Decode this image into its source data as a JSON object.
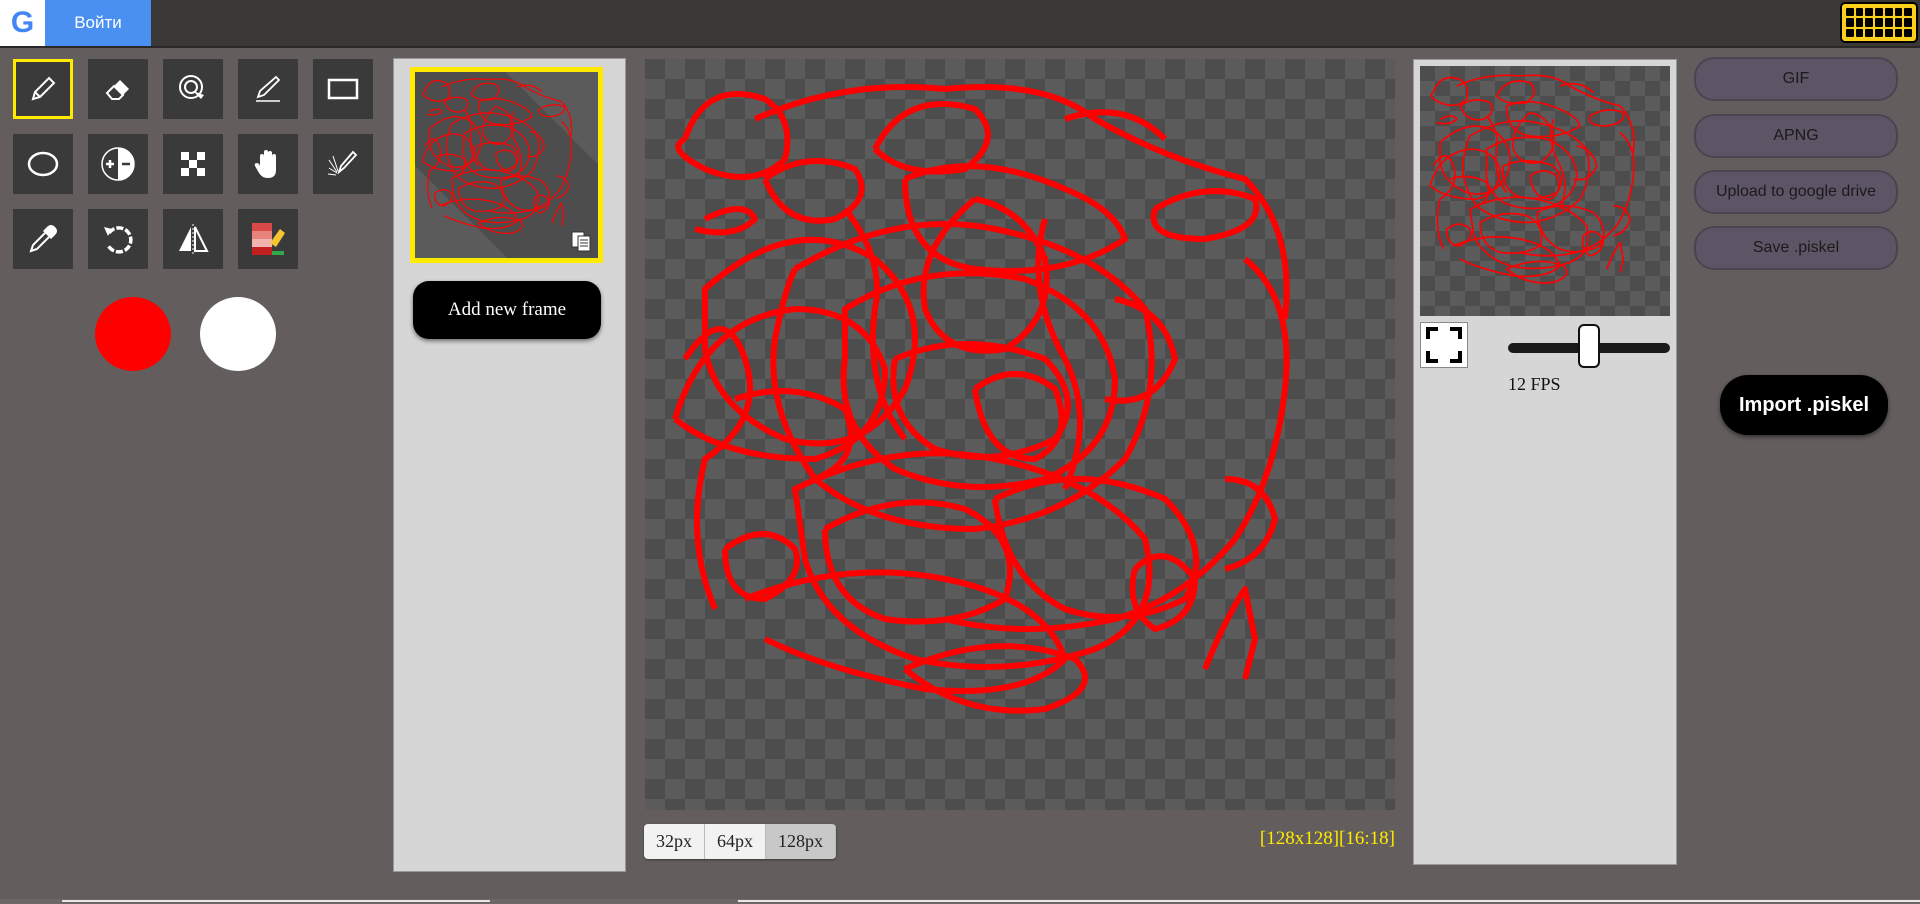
{
  "topbar": {
    "google_letter": "G",
    "login_label": "Войти",
    "keyboard_icon": "keyboard-icon"
  },
  "tools": [
    {
      "name": "pen-tool",
      "icon": "pencil-icon",
      "selected": true
    },
    {
      "name": "eraser-tool",
      "icon": "eraser-icon",
      "selected": false
    },
    {
      "name": "magic-wand-tool",
      "icon": "target-lasso-icon",
      "selected": false
    },
    {
      "name": "stroke-tool",
      "icon": "stroke-pen-icon",
      "selected": false
    },
    {
      "name": "rectangle-tool",
      "icon": "rectangle-icon",
      "selected": false
    },
    {
      "name": "ellipse-tool",
      "icon": "ellipse-icon",
      "selected": false
    },
    {
      "name": "lighten-tool",
      "icon": "lighten-darken-icon",
      "selected": false
    },
    {
      "name": "dither-tool",
      "icon": "checkerboard-icon",
      "selected": false
    },
    {
      "name": "move-tool",
      "icon": "hand-icon",
      "selected": false
    },
    {
      "name": "spray-tool",
      "icon": "spray-pen-icon",
      "selected": false
    },
    {
      "name": "eyedropper-tool",
      "icon": "eyedropper-icon",
      "selected": false
    },
    {
      "name": "rotate-tool",
      "icon": "rotate-icon",
      "selected": false
    },
    {
      "name": "flip-tool",
      "icon": "mirror-flip-icon",
      "selected": false
    },
    {
      "name": "palette-tool",
      "icon": "color-palette-icon",
      "selected": false
    }
  ],
  "colors": {
    "primary": "#ff0000",
    "secondary": "#ffffff",
    "highlight": "#ffea00",
    "stroke": "#ff0000"
  },
  "frames": {
    "add_frame_label": "Add new frame",
    "duplicate_icon": "duplicate-icon"
  },
  "canvas": {
    "size_buttons": [
      "32px",
      "64px",
      "128px"
    ],
    "active_size": "128px",
    "info": "[128x128][16:18]"
  },
  "preview": {
    "fps_label": "12 FPS",
    "fps_value": 12,
    "fps_max": 24,
    "fullscreen_icon": "fullscreen-icon"
  },
  "export": {
    "buttons": [
      "GIF",
      "APNG",
      "Upload to google drive",
      "Save .piskel"
    ],
    "import_label": "Import .piskel"
  }
}
